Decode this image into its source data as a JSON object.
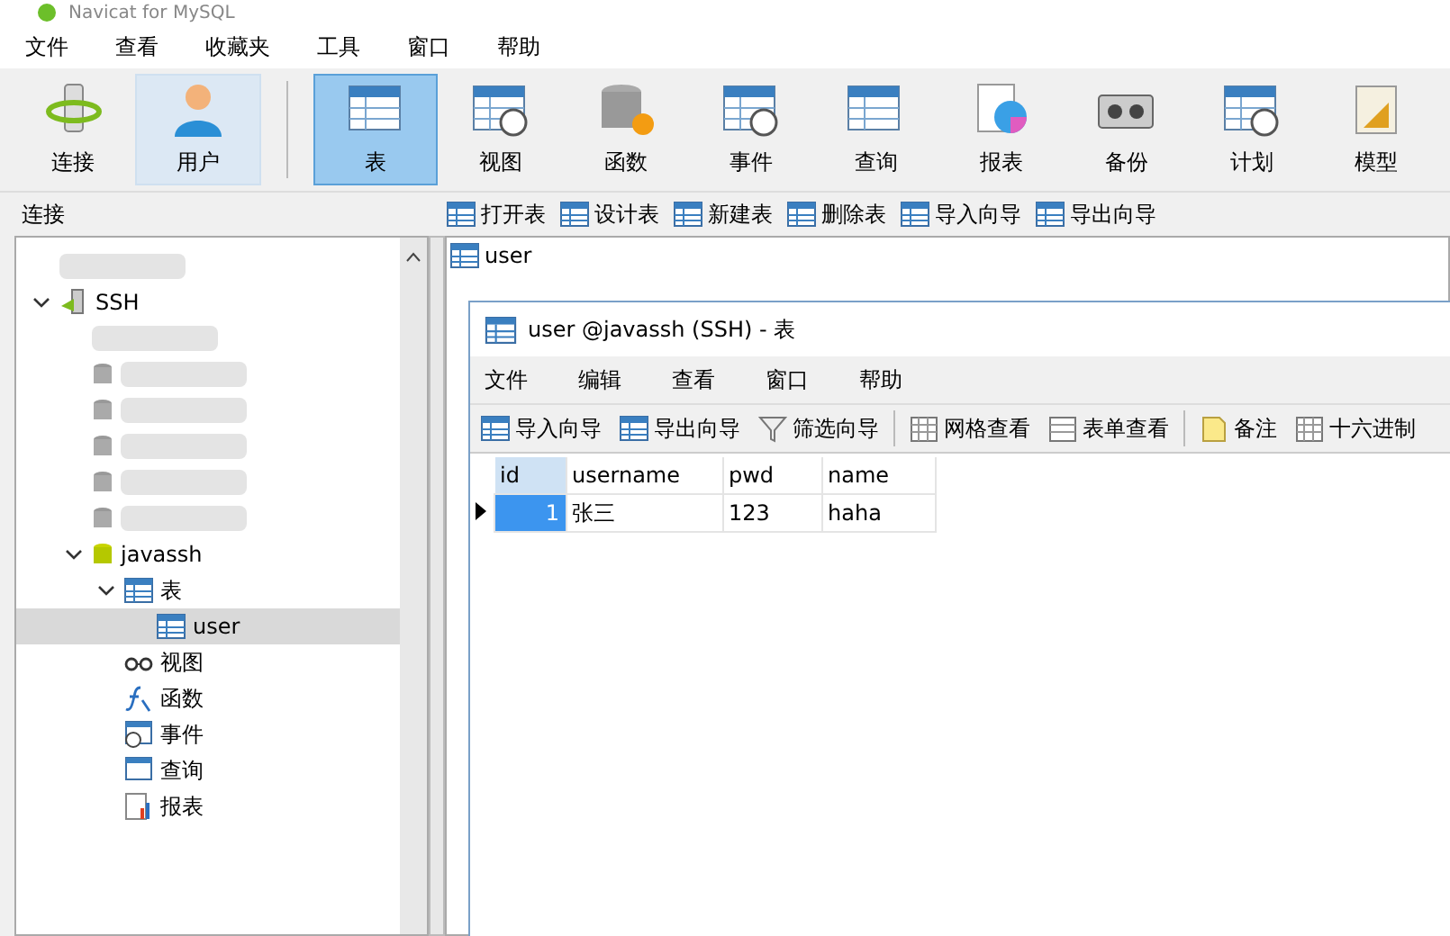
{
  "window": {
    "title": "Navicat for MySQL"
  },
  "menu": [
    "文件",
    "查看",
    "收藏夹",
    "工具",
    "窗口",
    "帮助"
  ],
  "toolbar": [
    {
      "label": "连接",
      "selected": false,
      "hovered": false
    },
    {
      "label": "用户",
      "selected": false,
      "hovered": true
    },
    {
      "label": "表",
      "selected": true,
      "hovered": false
    },
    {
      "label": "视图",
      "selected": false,
      "hovered": false
    },
    {
      "label": "函数",
      "selected": false,
      "hovered": false
    },
    {
      "label": "事件",
      "selected": false,
      "hovered": false
    },
    {
      "label": "查询",
      "selected": false,
      "hovered": false
    },
    {
      "label": "报表",
      "selected": false,
      "hovered": false
    },
    {
      "label": "备份",
      "selected": false,
      "hovered": false
    },
    {
      "label": "计划",
      "selected": false,
      "hovered": false
    },
    {
      "label": "模型",
      "selected": false,
      "hovered": false
    }
  ],
  "sidebar": {
    "title": "连接",
    "tree": [
      {
        "kind": "redacted"
      },
      {
        "kind": "connection",
        "label": "SSH",
        "expanded": true,
        "selected": false,
        "children": [
          {
            "kind": "redacted"
          },
          {
            "kind": "redacted-db"
          },
          {
            "kind": "redacted-db"
          },
          {
            "kind": "redacted-db"
          },
          {
            "kind": "redacted-db"
          },
          {
            "kind": "redacted-db"
          },
          {
            "kind": "database",
            "label": "javassh",
            "expanded": true,
            "selected": false,
            "children": [
              {
                "kind": "tables",
                "label": "表",
                "expanded": true,
                "selected": false,
                "children": [
                  {
                    "kind": "table",
                    "label": "user",
                    "selected": true
                  }
                ]
              },
              {
                "kind": "views",
                "label": "视图",
                "selected": false
              },
              {
                "kind": "functions",
                "label": "函数",
                "selected": false
              },
              {
                "kind": "events",
                "label": "事件",
                "selected": false
              },
              {
                "kind": "queries",
                "label": "查询",
                "selected": false
              },
              {
                "kind": "reports",
                "label": "报表",
                "selected": false
              }
            ]
          }
        ]
      }
    ]
  },
  "object_actions": [
    "打开表",
    "设计表",
    "新建表",
    "删除表",
    "导入向导",
    "导出向导"
  ],
  "objects": [
    {
      "label": "user",
      "selected": false
    }
  ],
  "table_window": {
    "title": "user @javassh (SSH) - 表",
    "menu": [
      "文件",
      "编辑",
      "查看",
      "窗口",
      "帮助"
    ],
    "toolbar": [
      {
        "kind": "import",
        "label": "导入向导"
      },
      {
        "kind": "export",
        "label": "导出向导"
      },
      {
        "kind": "filter",
        "label": "筛选向导"
      },
      {
        "kind": "separator"
      },
      {
        "kind": "grid",
        "label": "网格查看"
      },
      {
        "kind": "form",
        "label": "表单查看"
      },
      {
        "kind": "separator"
      },
      {
        "kind": "note",
        "label": "备注"
      },
      {
        "kind": "hex",
        "label": "十六进制"
      }
    ],
    "columns": [
      "id",
      "username",
      "pwd",
      "name"
    ],
    "rows": [
      {
        "current": true,
        "cells": [
          {
            "text": "1",
            "selected": true
          },
          {
            "text": "张三",
            "selected": false
          },
          {
            "text": "123",
            "selected": false
          },
          {
            "text": "haha",
            "selected": false
          }
        ]
      }
    ]
  }
}
